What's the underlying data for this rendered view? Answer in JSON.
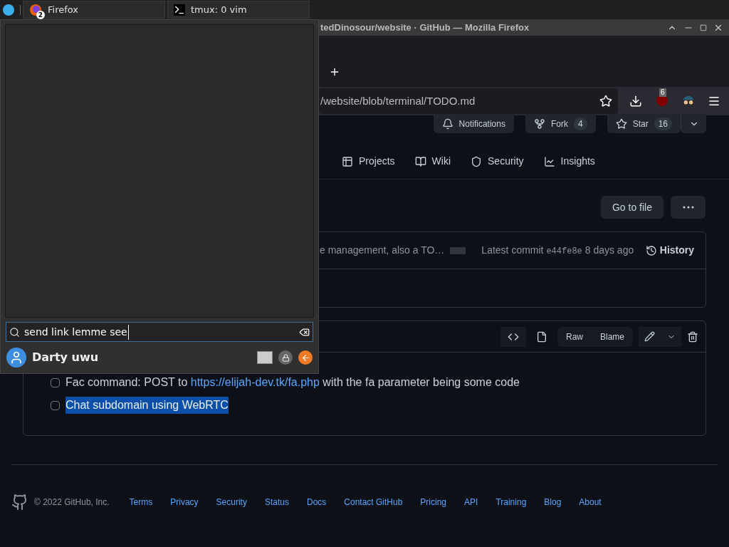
{
  "taskbar": {
    "items": [
      {
        "kind": "firefox",
        "label": "Firefox",
        "badge": "2"
      },
      {
        "kind": "terminal",
        "label": "tmux: 0 vim"
      }
    ]
  },
  "browser": {
    "title": "tedDinosour/website · GitHub — Mozilla Firefox",
    "url": "/website/blob/terminal/TODO.md",
    "extension_badge": "6"
  },
  "repo_actions": [
    {
      "kind": "bell",
      "label": "Notifications"
    },
    {
      "kind": "fork",
      "label": "Fork",
      "count": "4"
    },
    {
      "kind": "star",
      "label": "Star",
      "count": "16"
    }
  ],
  "repo_tabs": [
    {
      "kind": "projects",
      "label": "Projects"
    },
    {
      "kind": "wiki",
      "label": "Wiki"
    },
    {
      "kind": "security",
      "label": "Security"
    },
    {
      "kind": "insights",
      "label": "Insights"
    }
  ],
  "go_to_file": "Go to file",
  "commit": {
    "message": "e management, also a TO…",
    "prefix": "Latest commit",
    "sha": "e44fe8e",
    "age": "8 days ago",
    "history": "History"
  },
  "file_toolbar": [
    "Raw",
    "Blame"
  ],
  "todo_items": [
    {
      "text": "Fac command: POST to ",
      "link": "https://elijah-dev.tk/fa.php",
      "after": " with the fa parameter being some code",
      "checked": false,
      "highlighted": false
    },
    {
      "text": "Chat subdomain using WebRTC",
      "checked": false,
      "highlighted": true
    }
  ],
  "footer": {
    "copyright": "© 2022 GitHub, Inc.",
    "links": [
      "Terms",
      "Privacy",
      "Security",
      "Status",
      "Docs",
      "Contact GitHub",
      "Pricing",
      "API",
      "Training",
      "Blog",
      "About"
    ]
  },
  "popup": {
    "search": {
      "value": "send link lemme see"
    },
    "contact": {
      "name": "Darty uwu"
    }
  }
}
